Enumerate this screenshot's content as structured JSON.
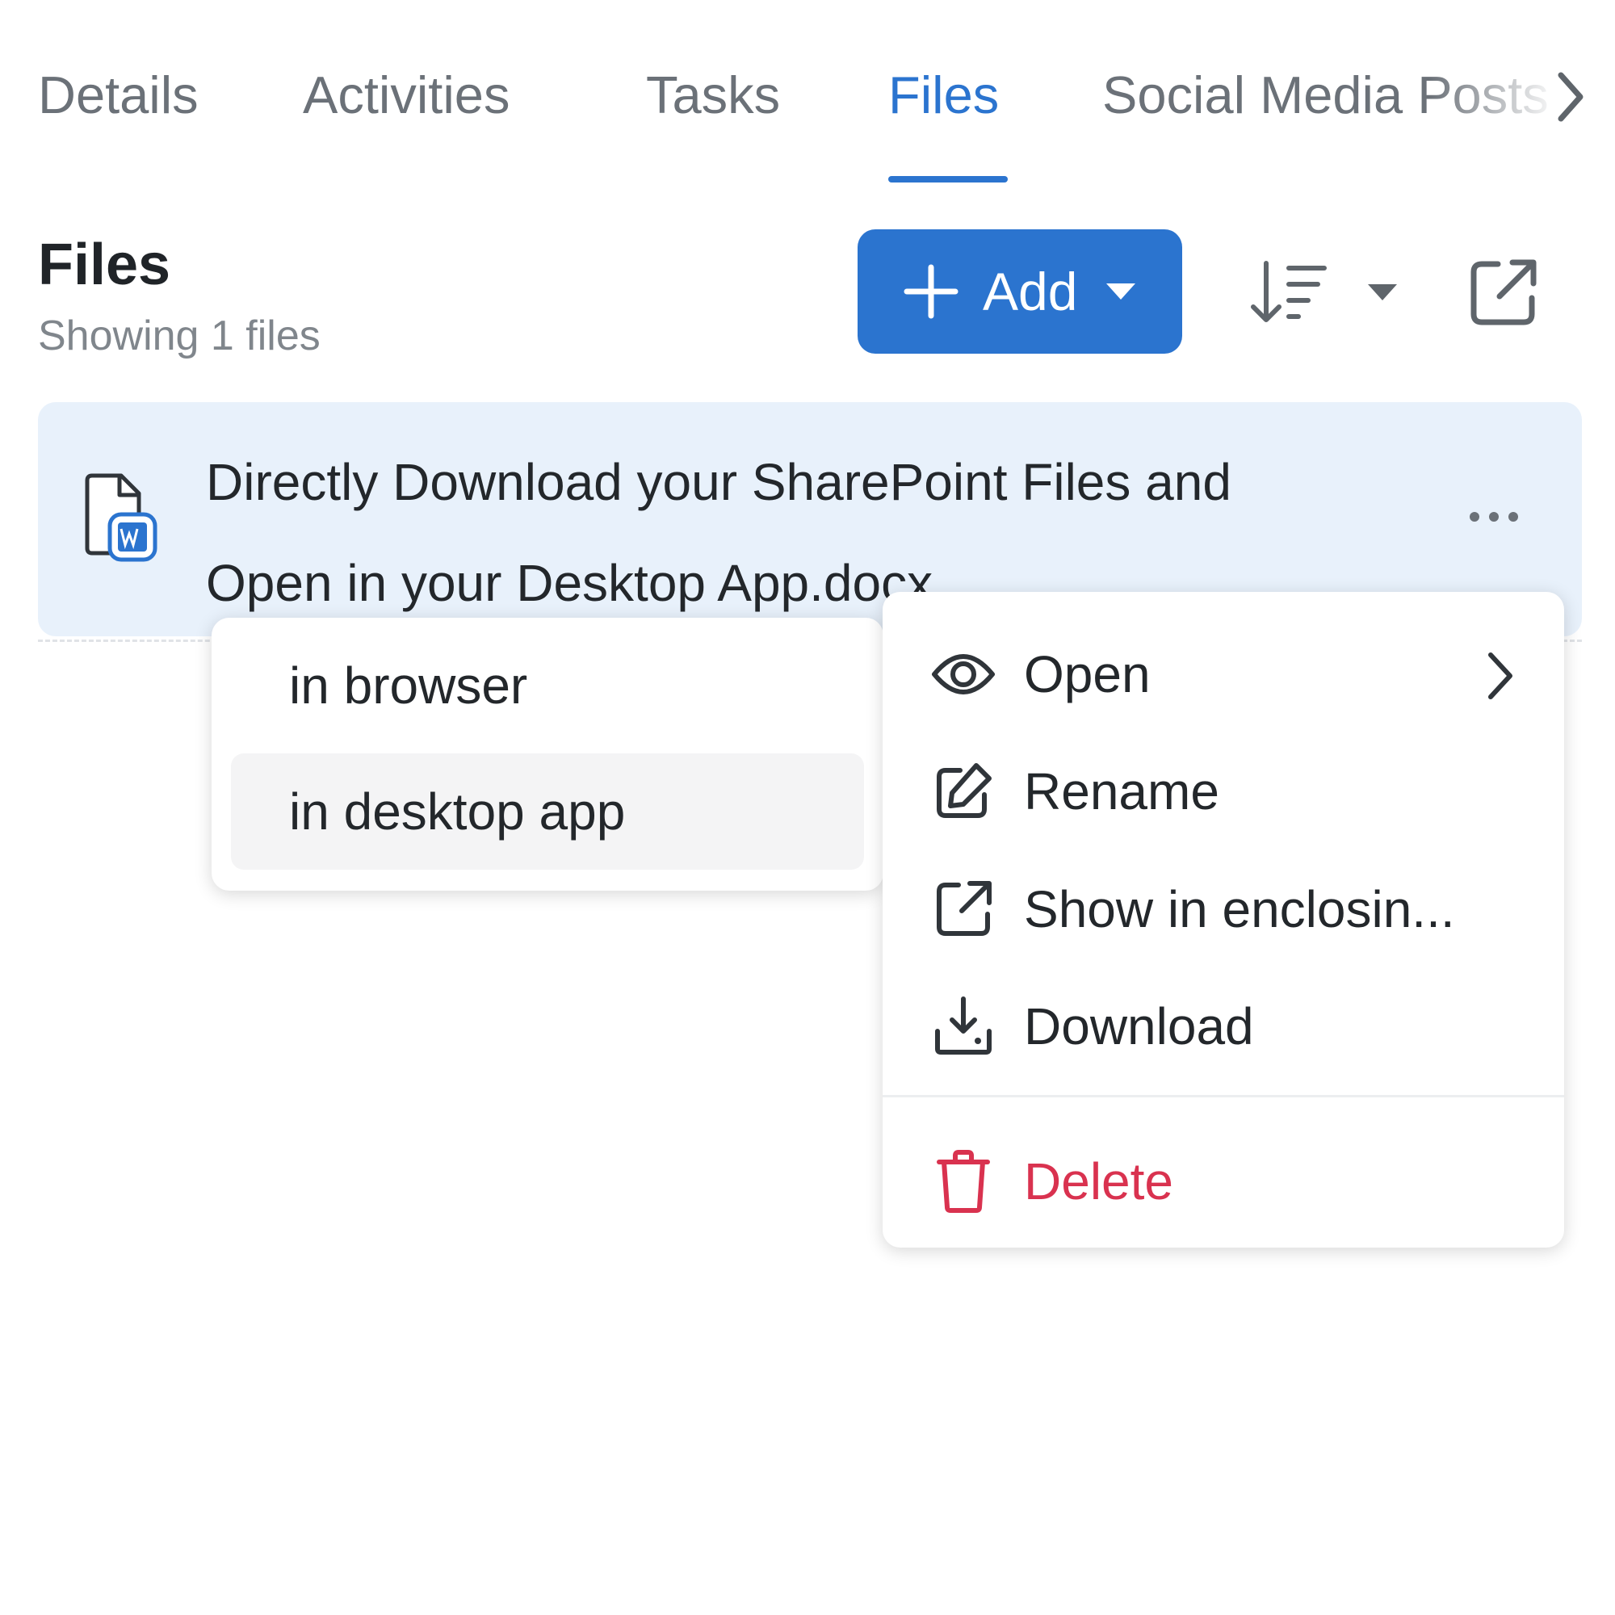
{
  "tabs": [
    {
      "label": "Details"
    },
    {
      "label": "Activities"
    },
    {
      "label": "Tasks"
    },
    {
      "label": "Files",
      "active": true
    },
    {
      "label": "Social Media Posts"
    }
  ],
  "header": {
    "title": "Files",
    "count_text": "Showing 1 files",
    "add_label": "Add"
  },
  "file": {
    "name": "Directly Download your SharePoint Files and Open in your Desktop App.docx",
    "icon": "word-document-icon"
  },
  "submenu": {
    "items": [
      {
        "label": "in browser"
      },
      {
        "label": "in desktop app",
        "hovered": true
      }
    ]
  },
  "context_menu": {
    "items": [
      {
        "label": "Open",
        "icon": "eye-icon",
        "has_submenu": true
      },
      {
        "label": "Rename",
        "icon": "edit-icon"
      },
      {
        "label": "Show in enclosin...",
        "icon": "external-link-icon"
      },
      {
        "label": "Download",
        "icon": "download-icon"
      },
      {
        "label": "Delete",
        "icon": "trash-icon",
        "danger": true
      }
    ]
  },
  "colors": {
    "accent": "#2b74cf",
    "row_highlight": "#e8f1fb",
    "danger": "#d9324f",
    "muted_text": "#6b7178"
  }
}
